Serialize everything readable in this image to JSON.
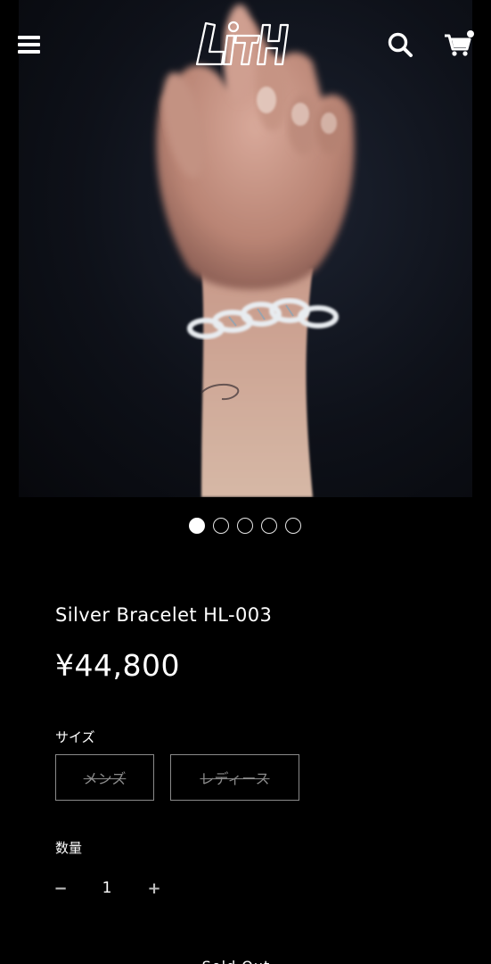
{
  "header": {
    "menu_icon": "hamburger-menu-icon",
    "logo_text": "LITH",
    "search_icon": "search-icon",
    "cart_icon": "shopping-cart-icon",
    "cart_badge_color": "#ffffff"
  },
  "gallery": {
    "image_count": 5,
    "active_index": 0,
    "dot_active_color": "#ffffff",
    "dot_inactive_color": "#e6e6e6"
  },
  "product": {
    "title": "Silver Bracelet HL-003",
    "price": "¥44,800"
  },
  "size": {
    "label": "サイズ",
    "options": [
      {
        "label": "メンズ",
        "available": false
      },
      {
        "label": "レディース",
        "available": false
      }
    ]
  },
  "quantity": {
    "label": "数量",
    "value": "1",
    "minus_label": "−",
    "plus_label": "+"
  },
  "cta": {
    "label": "Sold Out"
  },
  "colors": {
    "background": "#000000",
    "text": "#ffffff",
    "muted": "#8a8a8a"
  }
}
